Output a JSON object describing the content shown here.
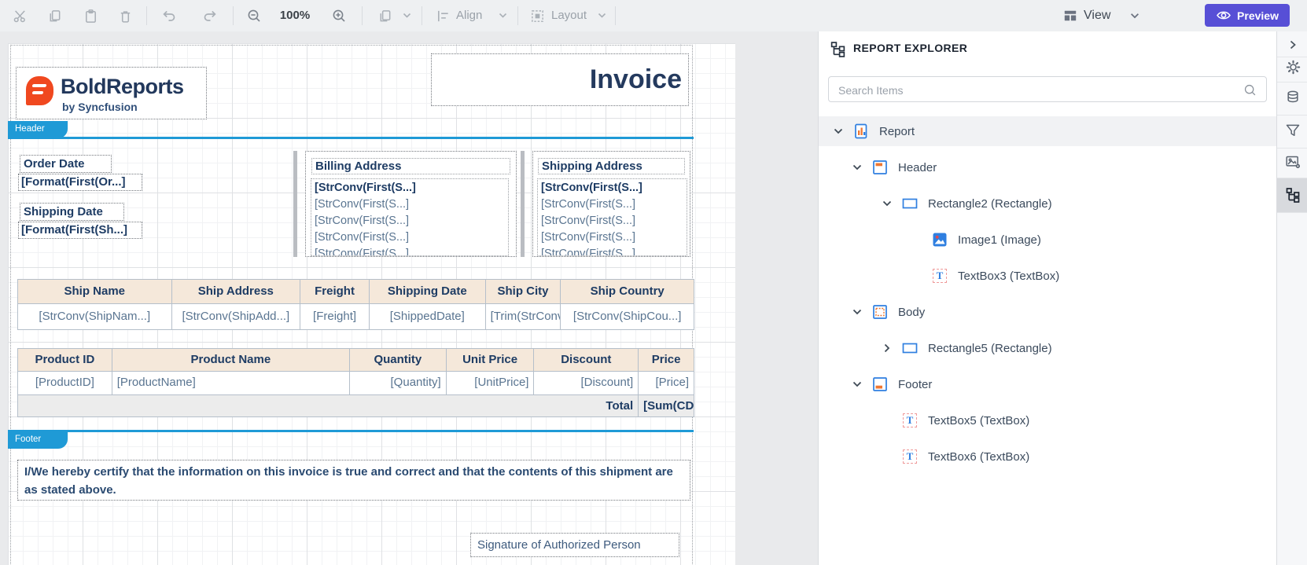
{
  "toolbar": {
    "zoom_level": "100%",
    "align_label": "Align",
    "layout_label": "Layout",
    "view_label": "View",
    "preview_label": "Preview"
  },
  "canvas": {
    "logo": {
      "brand": "BoldReports",
      "sub": "by Syncfusion"
    },
    "invoice_title": "Invoice",
    "header_tab": "Header",
    "footer_tab": "Footer",
    "order_date": {
      "label": "Order Date",
      "value": "[Format(First(Or...]"
    },
    "shipping_date": {
      "label": "Shipping Date",
      "value": "[Format(First(Sh...]"
    },
    "billing_address": {
      "label": "Billing Address",
      "bold_line": "[StrConv(First(S...]",
      "lines": [
        "[StrConv(First(S...]",
        "[StrConv(First(S...]",
        "[StrConv(First(S...]",
        "[StrConv(First(S...]"
      ]
    },
    "shipping_address": {
      "label": "Shipping Address",
      "bold_line": "[StrConv(First(S...]",
      "lines": [
        "[StrConv(First(S...]",
        "[StrConv(First(S...]",
        "[StrConv(First(S...]",
        "[StrConv(First(S...]"
      ]
    },
    "ship_table": {
      "headers": [
        "Ship Name",
        "Ship Address",
        "Freight",
        "Shipping Date",
        "Ship City",
        "Ship Country"
      ],
      "row": [
        "[StrConv(ShipNam...]",
        "[StrConv(ShipAdd...]",
        "[Freight]",
        "[ShippedDate]",
        "[Trim(StrConv(",
        "[StrConv(ShipCou...]"
      ]
    },
    "product_table": {
      "headers": [
        "Product ID",
        "Product Name",
        "Quantity",
        "Unit Price",
        "Discount",
        "Price"
      ],
      "row": [
        "[ProductID]",
        "[ProductName]",
        "[Quantity]",
        "[UnitPrice]",
        "[Discount]",
        "[Price]"
      ],
      "total_label": "Total",
      "total_value": "[Sum(CDec(F"
    },
    "certify_text": "I/We hereby certify that the information on this invoice is true and correct and that the contents of this shipment are as stated above.",
    "signature_text": "Signature of Authorized Person"
  },
  "explorer": {
    "title": "REPORT EXPLORER",
    "search_placeholder": "Search Items",
    "tree": [
      {
        "label": "Report"
      },
      {
        "label": "Header"
      },
      {
        "label": "Rectangle2 (Rectangle)"
      },
      {
        "label": "Image1 (Image)"
      },
      {
        "label": "TextBox3 (TextBox)"
      },
      {
        "label": "Body"
      },
      {
        "label": "Rectangle5 (Rectangle)"
      },
      {
        "label": "Footer"
      },
      {
        "label": "TextBox5 (TextBox)"
      },
      {
        "label": "TextBox6 (TextBox)"
      }
    ]
  },
  "colors": {
    "accent_blue": "#1f9ad6",
    "preview_purple": "#574fd6",
    "navy": "#1e3c64",
    "brand_orange": "#f0481f"
  }
}
